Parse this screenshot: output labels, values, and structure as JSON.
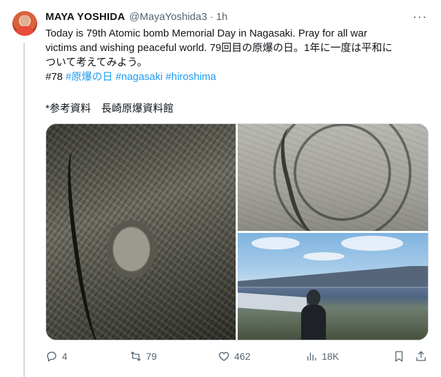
{
  "author": {
    "name": "MAYA YOSHIDA",
    "handle": "@MayaYoshida3",
    "separator": "·",
    "time": "1h"
  },
  "more_label": "···",
  "tweet": {
    "line1": "Today is 79th Atomic bomb Memorial Day in Nagasaki. Pray for all war",
    "line2": "victims and wishing peaceful world. 79回目の原爆の日。1年に一度は平和に",
    "line3": "ついて考えてみよう。",
    "number_tag": "#78",
    "hashtags": [
      "#原爆の日",
      "#nagasaki",
      "#hiroshima"
    ],
    "reference": "*参考資料　長崎原爆資料館"
  },
  "actions": {
    "replies": "4",
    "retweets": "79",
    "likes": "462",
    "views": "18K"
  }
}
